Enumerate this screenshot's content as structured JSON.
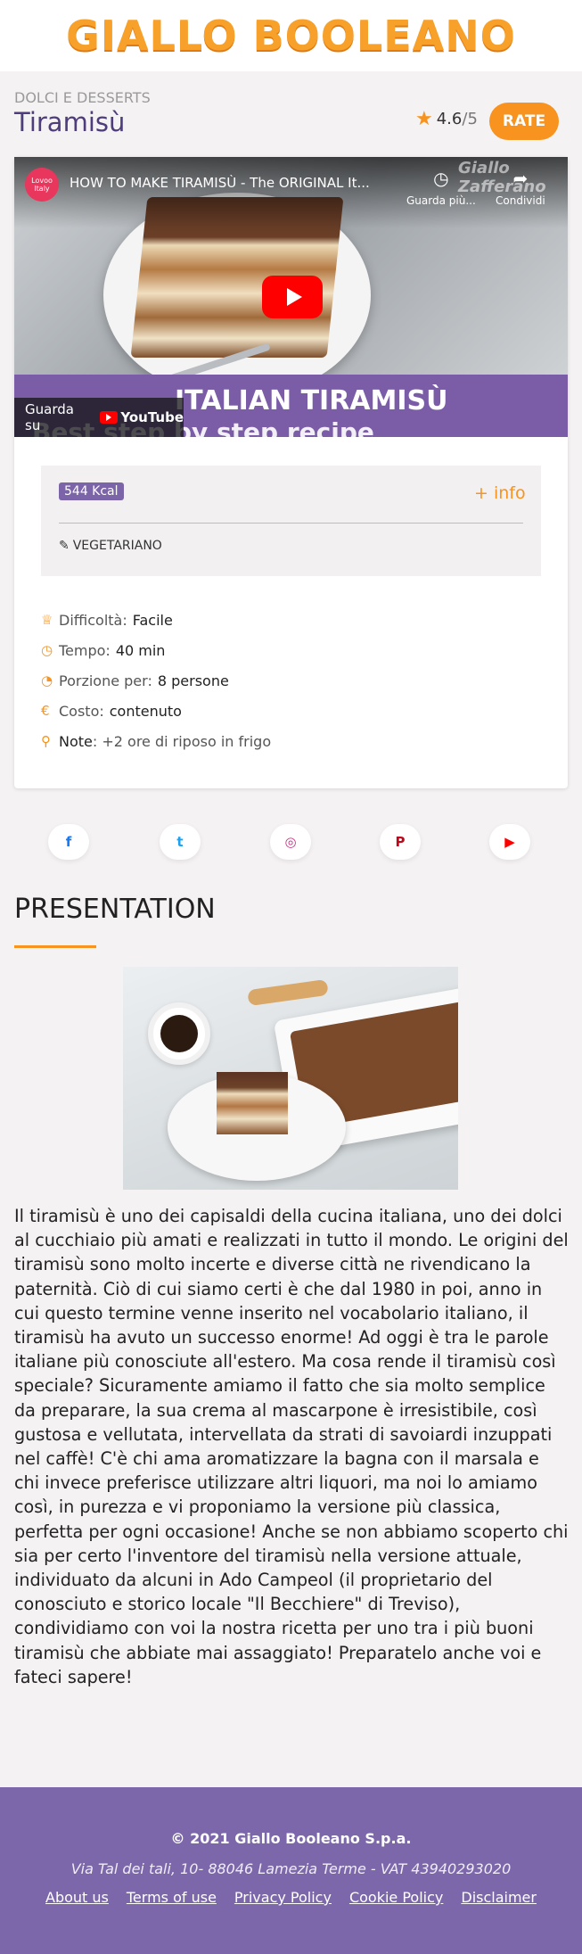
{
  "header": {
    "logo": "GIALLO BOOLEANO"
  },
  "recipe": {
    "category": "DOLCI E DESSERTS",
    "title": "Tiramisù",
    "rating_value": "4.6",
    "rating_denominator": "/5",
    "rate_label": "RATE"
  },
  "video": {
    "channel": "Lovoo Italy",
    "title": "HOW TO MAKE TIRAMISÙ - The ORIGINAL It...",
    "watch_later": "Guarda più...",
    "share": "Condividi",
    "watermark": "Giallo Zafferano",
    "banner_line1": "ITALIAN TIRAMISÙ",
    "banner_line2": "Best step by step recipe",
    "watch_on": "Guarda su",
    "youtube": "YouTube"
  },
  "nutrition": {
    "kcal": "544 Kcal",
    "info_link": "+ info",
    "tag": "VEGETARIANO"
  },
  "details": [
    {
      "icon": "trophy-icon",
      "label": "Difficoltà:",
      "value": "Facile"
    },
    {
      "icon": "clock-icon",
      "label": "Tempo:",
      "value": "40 min"
    },
    {
      "icon": "pie-icon",
      "label": "Porzione per:",
      "value": "8 persone"
    },
    {
      "icon": "euro-icon",
      "label": "Costo:",
      "value": "contenuto"
    },
    {
      "icon": "pin-icon",
      "label": "Note",
      "value": ": +2 ore di riposo in frigo"
    }
  ],
  "social": [
    {
      "name": "facebook",
      "glyph": "f",
      "color": "#1877f2"
    },
    {
      "name": "twitter",
      "glyph": "t",
      "color": "#1da1f2"
    },
    {
      "name": "instagram",
      "glyph": "◎",
      "color": "#c13584"
    },
    {
      "name": "pinterest",
      "glyph": "P",
      "color": "#bd081c"
    },
    {
      "name": "youtube",
      "glyph": "▶",
      "color": "#ff0000"
    }
  ],
  "presentation": {
    "title": "PRESENTATION",
    "text": "Il tiramisù è uno dei capisaldi della cucina italiana, uno dei dolci al cucchiaio più amati e realizzati in tutto il mondo. Le origini del tiramisù sono molto incerte e diverse città ne rivendicano la paternità. Ciò di cui siamo certi è che dal 1980 in poi, anno in cui questo termine venne inserito nel vocabolario italiano, il tiramisù ha avuto un successo enorme! Ad oggi è tra le parole italiane più conosciute all'estero. Ma cosa rende il tiramisù così speciale? Sicuramente amiamo il fatto che sia molto semplice da preparare, la sua crema al mascarpone è irresistibile, così gustosa e vellutata, intervellata da strati di savoiardi inzuppati nel caffè! C'è chi ama aromatizzare la bagna con il marsala e chi invece preferisce utilizzare altri liquori, ma noi lo amiamo così, in purezza e vi proponiamo la versione più classica, perfetta per ogni occasione! Anche se non abbiamo scoperto chi sia per certo l'inventore del tiramisù nella versione attuale, individuato da alcuni in Ado Campeol (il proprietario del conosciuto e storico locale \"Il Becchiere\" di Treviso), condividiamo con voi la nostra ricetta per uno tra i più buoni tiramisù che abbiate mai assaggiato! Preparatelo anche voi e fateci sapere!"
  },
  "footer": {
    "copyright": "© 2021 Giallo Booleano S.p.a.",
    "address": "Via Tal dei tali, 10- 88046 Lamezia Terme - VAT 43940293020",
    "links": [
      "About us",
      "Terms of use",
      "Privacy Policy",
      "Cookie Policy",
      "Disclaimer"
    ]
  },
  "colors": {
    "accent": "#f7931e",
    "purple": "#7b67a9",
    "title_purple": "#4e3d7c"
  }
}
